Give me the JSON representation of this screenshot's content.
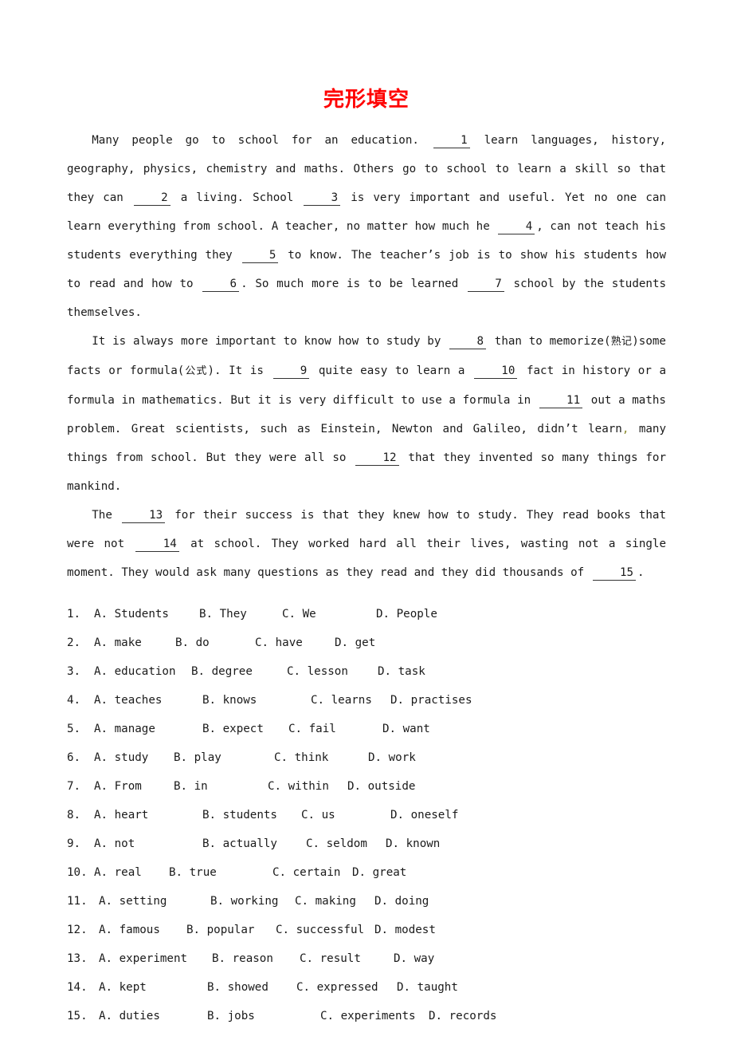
{
  "document": {
    "title": "完形填空",
    "title_color": "#ff0000",
    "body_text_color": "#1a1a1a"
  },
  "passage": {
    "paragraph1": {
      "seg1": "Many people go to school for an education.",
      "blank1": "1",
      "seg2": "learn languages, history, geography, physics, chemistry and maths. Others go to school to learn a skill so that they can",
      "blank2": "2",
      "seg3": "a living. School",
      "blank3": "3",
      "seg4": "is very important and useful. Yet no one can learn everything from school. A teacher, no matter how much he",
      "blank4": "4",
      "seg5": ", can not teach his students everything they",
      "blank5": "5",
      "seg6": "to know. The teacher’s job is to show his students how to read and how to",
      "blank6": "6",
      "seg7": ". So much more is to be learned",
      "blank7": "7",
      "seg8": "school by the students themselves."
    },
    "paragraph2": {
      "seg1": "It is always more important to know how to study by",
      "blank8": "8",
      "seg2": "than to memorize(",
      "cjk1": "熟记",
      "seg3": ")some facts or formula(",
      "cjk2": "公式",
      "seg4": "). It is",
      "blank9": "9",
      "seg5": "quite easy to learn a",
      "blank10": "10",
      "seg6": "fact in history or a formula in mathematics. But it is very difficult to use a formula in",
      "blank11": "11",
      "seg7": "out a maths problem. Great scientists, such as Einstein, Newton and Galileo, didn’t learn",
      "stray_mark": ",",
      "seg8": "many things from school. But they were all so",
      "blank12": "12",
      "seg9": "that they invented so many things for mankind."
    },
    "paragraph3": {
      "seg1": "The",
      "blank13": "13",
      "seg2": "for their success is that they knew how to study. They read books that were not",
      "blank14": "14",
      "seg3": "at school. They worked hard all their lives, wasting not a single moment. They would ask many questions as they read and they did thousands of",
      "blank15": "15",
      "seg4": "."
    }
  },
  "questions": [
    {
      "number": "1.",
      "options": [
        {
          "letter": "A.",
          "text": "Students"
        },
        {
          "letter": "B.",
          "text": "They"
        },
        {
          "letter": "C.",
          "text": "We"
        },
        {
          "letter": "D.",
          "text": "People"
        }
      ]
    },
    {
      "number": "2.",
      "options": [
        {
          "letter": "A.",
          "text": "make"
        },
        {
          "letter": "B.",
          "text": "do"
        },
        {
          "letter": "C.",
          "text": "have"
        },
        {
          "letter": "D.",
          "text": "get"
        }
      ]
    },
    {
      "number": "3.",
      "options": [
        {
          "letter": "A.",
          "text": "education"
        },
        {
          "letter": "B.",
          "text": "degree"
        },
        {
          "letter": "C.",
          "text": "lesson"
        },
        {
          "letter": "D.",
          "text": "task"
        }
      ]
    },
    {
      "number": "4.",
      "options": [
        {
          "letter": "A.",
          "text": "teaches"
        },
        {
          "letter": "B.",
          "text": "knows"
        },
        {
          "letter": "C.",
          "text": "learns"
        },
        {
          "letter": "D.",
          "text": "practises"
        }
      ]
    },
    {
      "number": "5.",
      "options": [
        {
          "letter": "A.",
          "text": "manage"
        },
        {
          "letter": "B.",
          "text": "expect"
        },
        {
          "letter": "C.",
          "text": "fail"
        },
        {
          "letter": "D.",
          "text": "want"
        }
      ]
    },
    {
      "number": "6.",
      "options": [
        {
          "letter": "A.",
          "text": "study"
        },
        {
          "letter": "B.",
          "text": "play"
        },
        {
          "letter": "C.",
          "text": "think"
        },
        {
          "letter": "D.",
          "text": "work"
        }
      ]
    },
    {
      "number": "7.",
      "options": [
        {
          "letter": "A.",
          "text": "From"
        },
        {
          "letter": "B.",
          "text": "in"
        },
        {
          "letter": "C.",
          "text": "within"
        },
        {
          "letter": "D.",
          "text": "outside"
        }
      ]
    },
    {
      "number": "8.",
      "options": [
        {
          "letter": "A.",
          "text": "heart"
        },
        {
          "letter": "B.",
          "text": "students"
        },
        {
          "letter": "C.",
          "text": "us"
        },
        {
          "letter": "D.",
          "text": "oneself"
        }
      ]
    },
    {
      "number": "9.",
      "options": [
        {
          "letter": "A.",
          "text": "not"
        },
        {
          "letter": "B.",
          "text": "actually"
        },
        {
          "letter": "C.",
          "text": "seldom"
        },
        {
          "letter": "D.",
          "text": "known"
        }
      ]
    },
    {
      "number": "10.",
      "options": [
        {
          "letter": "A.",
          "text": "real"
        },
        {
          "letter": "B.",
          "text": "true"
        },
        {
          "letter": "C.",
          "text": "certain"
        },
        {
          "letter": "D.",
          "text": "great"
        }
      ]
    },
    {
      "number": "11.",
      "options": [
        {
          "letter": "A.",
          "text": "setting"
        },
        {
          "letter": "B.",
          "text": "working"
        },
        {
          "letter": "C.",
          "text": "making"
        },
        {
          "letter": "D.",
          "text": "doing"
        }
      ]
    },
    {
      "number": "12.",
      "options": [
        {
          "letter": "A.",
          "text": "famous"
        },
        {
          "letter": "B.",
          "text": "popular"
        },
        {
          "letter": "C.",
          "text": "successful"
        },
        {
          "letter": "D.",
          "text": "modest"
        }
      ]
    },
    {
      "number": "13.",
      "options": [
        {
          "letter": "A.",
          "text": "experiment"
        },
        {
          "letter": "B.",
          "text": "reason"
        },
        {
          "letter": "C.",
          "text": "result"
        },
        {
          "letter": "D.",
          "text": "way"
        }
      ]
    },
    {
      "number": "14.",
      "options": [
        {
          "letter": "A.",
          "text": "kept"
        },
        {
          "letter": "B.",
          "text": "showed"
        },
        {
          "letter": "C.",
          "text": "expressed"
        },
        {
          "letter": "D.",
          "text": "taught"
        }
      ]
    },
    {
      "number": "15.",
      "options": [
        {
          "letter": "A.",
          "text": "duties"
        },
        {
          "letter": "B.",
          "text": "jobs"
        },
        {
          "letter": "C.",
          "text": "experiments"
        },
        {
          "letter": "D.",
          "text": "records"
        }
      ]
    }
  ],
  "option_columns": [
    {
      "num_w": 34,
      "a_w": 132,
      "b_w": 104,
      "c_w": 118
    },
    {
      "num_w": 34,
      "a_w": 102,
      "b_w": 100,
      "c_w": 100
    },
    {
      "num_w": 34,
      "a_w": 122,
      "b_w": 120,
      "c_w": 114
    },
    {
      "num_w": 34,
      "a_w": 136,
      "b_w": 136,
      "c_w": 100
    },
    {
      "num_w": 34,
      "a_w": 136,
      "b_w": 108,
      "c_w": 118
    },
    {
      "num_w": 34,
      "a_w": 100,
      "b_w": 126,
      "c_w": 118
    },
    {
      "num_w": 34,
      "a_w": 100,
      "b_w": 118,
      "c_w": 100
    },
    {
      "num_w": 34,
      "a_w": 136,
      "b_w": 124,
      "c_w": 112
    },
    {
      "num_w": 34,
      "a_w": 136,
      "b_w": 130,
      "c_w": 100
    },
    {
      "num_w": 34,
      "a_w": 94,
      "b_w": 130,
      "c_w": 100
    },
    {
      "num_w": 40,
      "a_w": 140,
      "b_w": 106,
      "c_w": 100
    },
    {
      "num_w": 40,
      "a_w": 110,
      "b_w": 112,
      "c_w": 124
    },
    {
      "num_w": 40,
      "a_w": 142,
      "b_w": 110,
      "c_w": 118
    },
    {
      "num_w": 40,
      "a_w": 136,
      "b_w": 112,
      "c_w": 126
    },
    {
      "num_w": 40,
      "a_w": 136,
      "b_w": 142,
      "c_w": 136
    }
  ]
}
